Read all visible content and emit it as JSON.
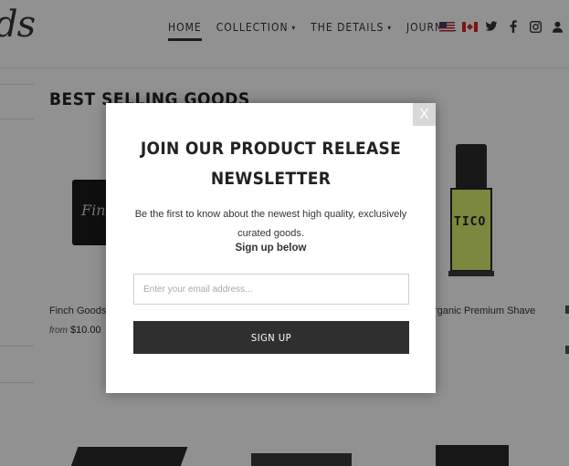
{
  "header": {
    "logo_text": "ds",
    "nav": [
      {
        "label": "HOME",
        "active": true,
        "has_dropdown": false
      },
      {
        "label": "COLLECTION",
        "active": false,
        "has_dropdown": true
      },
      {
        "label": "THE DETAILS",
        "active": false,
        "has_dropdown": true
      },
      {
        "label": "JOURNAL",
        "active": false,
        "has_dropdown": false
      }
    ],
    "caret_glyph": "▾",
    "icons": [
      "us-flag-icon",
      "canada-flag-icon",
      "twitter-icon",
      "facebook-icon",
      "instagram-icon",
      "account-icon"
    ]
  },
  "main": {
    "section_title": "BEST SELLING GOODS",
    "products": [
      {
        "name": "Finch Goods",
        "price_prefix": "from",
        "price": "$10.00",
        "image_text": "Fin"
      },
      {
        "name": "rganic Premium Shave",
        "image_text": "TICO"
      }
    ]
  },
  "modal": {
    "close_label": "X",
    "title": "JOIN OUR PRODUCT RELEASE NEWSLETTER",
    "body": "Be the first to know about the newest high quality, exclusively curated goods.",
    "subtext": "Sign up below",
    "email_placeholder": "Enter your email address...",
    "submit_label": "SIGN UP"
  },
  "colors": {
    "overlay": "#000000",
    "button_bg": "#2f2f2f",
    "close_bg": "#d8d8d8",
    "product_tube": "#d9f06b"
  }
}
